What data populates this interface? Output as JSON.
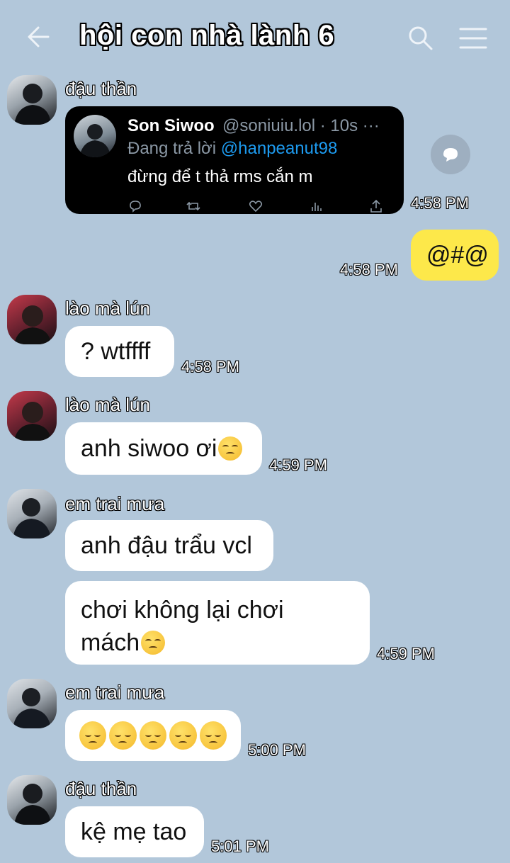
{
  "header": {
    "title": "hội con nhà lành 6",
    "back_icon": "arrow-left-icon",
    "search_icon": "search-icon",
    "menu_icon": "hamburger-menu-icon"
  },
  "colors": {
    "background": "#b2c7da",
    "bubble_other": "#ffffff",
    "bubble_mine": "#fde84a",
    "tweet_card": "#000000",
    "tweet_link": "#1d9bf0"
  },
  "messages": [
    {
      "sender": "đậu thần",
      "time": "4:58 PM",
      "tweet": {
        "name": "Son Siwoo",
        "handle_time": "@soniuiu.lol · 10s ···",
        "replying_prefix": "Đang trả lời",
        "replying_to": "@hanpeanut98",
        "text": "đừng để t thả rms cắn m"
      }
    },
    {
      "mine": true,
      "text": "@#@",
      "time": "4:58 PM"
    },
    {
      "sender": "lào mà lún",
      "text": "? wtffff",
      "time": "4:58 PM"
    },
    {
      "sender": "lào mà lún",
      "text": "anh siwoo ơi",
      "time": "4:59 PM"
    },
    {
      "sender": "em trai mưa",
      "text": "anh đậu trẩu vcl",
      "text2_line1": "chơi không lại chơi",
      "text2_line2": "mách",
      "time": "4:59 PM"
    },
    {
      "sender": "em trai mưa",
      "time": "5:00 PM"
    },
    {
      "sender": "đậu thần",
      "text": "kệ mẹ tao",
      "time": "5:01 PM"
    }
  ]
}
